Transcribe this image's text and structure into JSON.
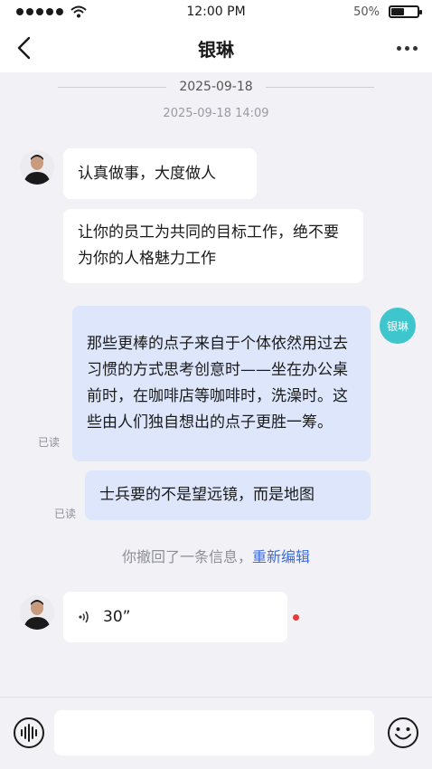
{
  "status_bar": {
    "time": "12:00 PM",
    "battery_text": "50%",
    "battery_level": 0.5,
    "icons": [
      "signal-icon",
      "wifi-icon",
      "battery-icon"
    ]
  },
  "nav": {
    "title": "银琳",
    "icons": [
      "back-icon",
      "more-icon"
    ]
  },
  "chat": {
    "date": "2025-09-18",
    "timestamp": "2025-09-18 14:09",
    "messages": [
      {
        "side": "in",
        "text": "认真做事，大度做人"
      },
      {
        "side": "in",
        "text": "让你的员工为共同的目标工作，绝不要为你的人格魅力工作"
      },
      {
        "side": "out",
        "text": "那些更棒的点子来自于个体依然用过去习惯的方式思考创意时——坐在办公桌前时，在咖啡店等咖啡时，洗澡时。这些由人们独自想出的点子更胜一筹。",
        "status": "已读"
      },
      {
        "side": "out",
        "text": "士兵要的不是望远镜，而是地图",
        "status": "已读"
      }
    ],
    "my_avatar_text": "银琳",
    "recall_notice": "你撤回了一条信息，",
    "recall_action": "重新编辑",
    "voice_message": {
      "duration": "30”",
      "unread": true
    }
  },
  "input_bar": {
    "placeholder": "",
    "icons": [
      "voice-input-icon",
      "emoji-icon"
    ]
  },
  "colors": {
    "outgoing_bubble": "#dde6fb",
    "incoming_bubble": "#ffffff",
    "avatar_me": "#3ec6cc",
    "link": "#3b6ce0",
    "unread_dot": "#e83a3a",
    "background": "#f2f2f6"
  }
}
